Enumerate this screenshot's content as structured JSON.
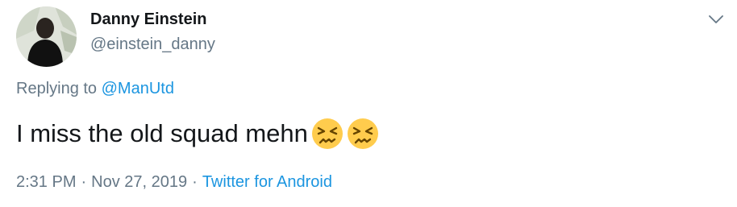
{
  "user": {
    "display_name": "Danny Einstein",
    "handle": "@einstein_danny"
  },
  "reply": {
    "prefix": "Replying to ",
    "mention": "@ManUtd"
  },
  "tweet": {
    "text": "I miss the old squad mehn",
    "emojis": [
      "persevering-face-emoji",
      "persevering-face-emoji"
    ]
  },
  "meta": {
    "time": "2:31 PM",
    "separator": "·",
    "date": "Nov 27, 2019",
    "source": "Twitter for Android"
  },
  "icons": {
    "caret": "chevron-down-icon"
  },
  "colors": {
    "text": "#14171a",
    "secondary": "#657786",
    "link": "#1b95e0"
  }
}
